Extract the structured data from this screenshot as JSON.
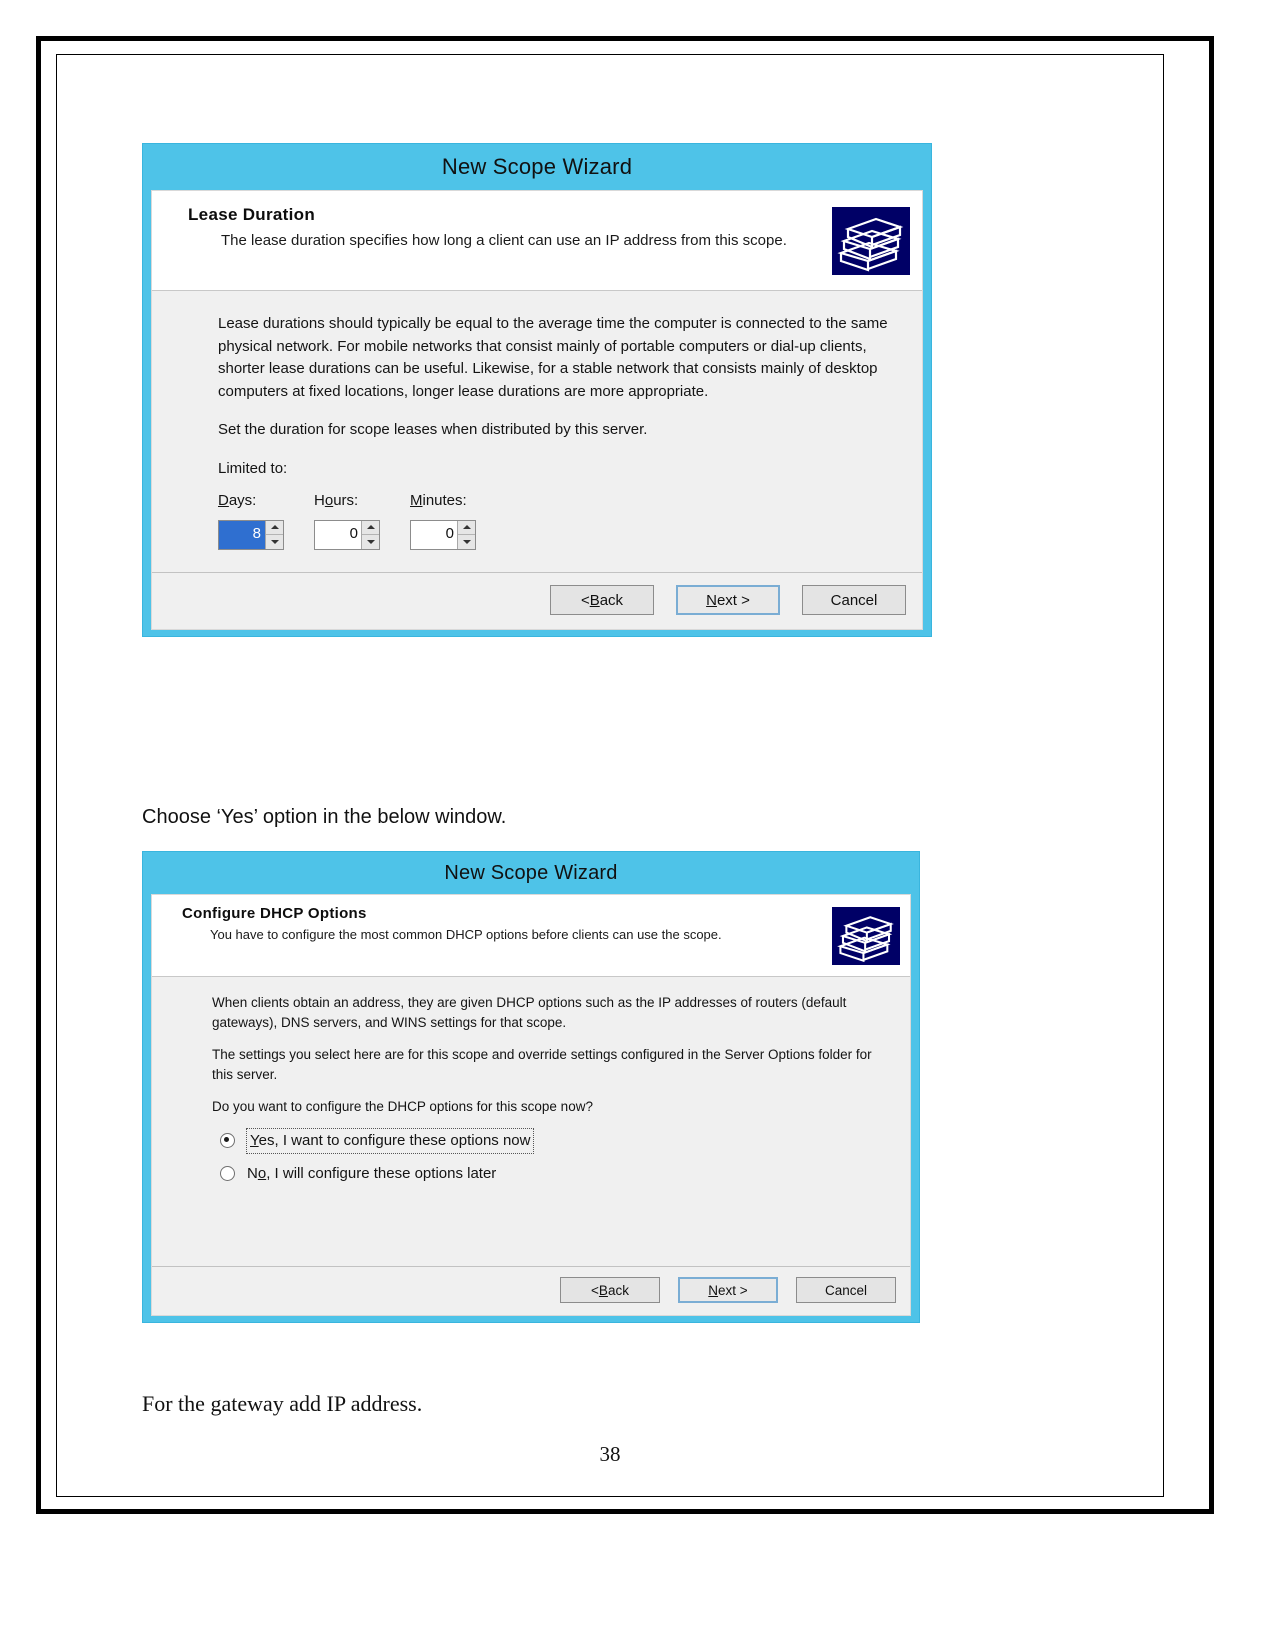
{
  "document": {
    "caption_after_first_dialog": "Choose ‘Yes’ option in the below window.",
    "caption_after_second_dialog": "For the gateway add IP address.",
    "page_number": "38"
  },
  "colors": {
    "titlebar": "#4ec3e8",
    "dialog_face": "#f0f0f0",
    "icon_background": "#000066",
    "selection": "#2f6fd0",
    "default_button_border": "#7aadd4"
  },
  "dialog_lease": {
    "title": "New Scope Wizard",
    "header_title": "Lease Duration",
    "header_subtitle": "The lease duration specifies how long a client can use an IP address from this scope.",
    "icon_name": "folder-stack-icon",
    "paragraphs": [
      "Lease durations should typically be equal to the average time the computer is connected to the same physical network. For mobile networks that consist mainly of portable computers or dial-up clients, shorter lease durations can be useful. Likewise, for a stable network that consists mainly of desktop computers at fixed locations, longer lease durations are more appropriate.",
      "Set the duration for scope leases when distributed by this server."
    ],
    "limited_to_label": "Limited to:",
    "fields": [
      {
        "label": "Days:",
        "accel": "D",
        "value": "8",
        "selected": true
      },
      {
        "label": "Hours:",
        "accel": "o",
        "value": "0",
        "selected": false
      },
      {
        "label": "Minutes:",
        "accel": "M",
        "value": "0",
        "selected": false
      }
    ],
    "buttons": [
      {
        "label_pre": "< ",
        "accel": "B",
        "label_post": "ack",
        "default": false,
        "name": "back-button"
      },
      {
        "label_pre": "",
        "accel": "N",
        "label_post": "ext >",
        "default": true,
        "name": "next-button"
      },
      {
        "label_pre": "",
        "accel": "",
        "label_post": "Cancel",
        "default": false,
        "name": "cancel-button"
      }
    ]
  },
  "dialog_dhcp": {
    "title": "New Scope Wizard",
    "header_title": "Configure DHCP Options",
    "header_subtitle": "You have to configure the most common DHCP options before clients can use the scope.",
    "icon_name": "folder-stack-icon",
    "paragraphs": [
      "When clients obtain an address, they are given DHCP options such as the IP addresses of routers (default gateways), DNS servers, and WINS settings for that scope.",
      "The settings you select here are for this scope and override settings configured in the Server Options folder for this server.",
      "Do you want to configure the DHCP options for this scope now?"
    ],
    "options": [
      {
        "label_pre": "",
        "accel": "Y",
        "label_post": "es, I want to configure these options now",
        "checked": true,
        "focused": true,
        "name": "radio-yes-configure-now"
      },
      {
        "label_pre": "N",
        "accel": "o",
        "label_post": ", I will configure these options later",
        "checked": false,
        "focused": false,
        "name": "radio-no-configure-later"
      }
    ],
    "buttons": [
      {
        "label_pre": "< ",
        "accel": "B",
        "label_post": "ack",
        "default": false,
        "name": "back-button"
      },
      {
        "label_pre": "",
        "accel": "N",
        "label_post": "ext >",
        "default": true,
        "name": "next-button"
      },
      {
        "label_pre": "",
        "accel": "",
        "label_post": "Cancel",
        "default": false,
        "name": "cancel-button"
      }
    ]
  }
}
